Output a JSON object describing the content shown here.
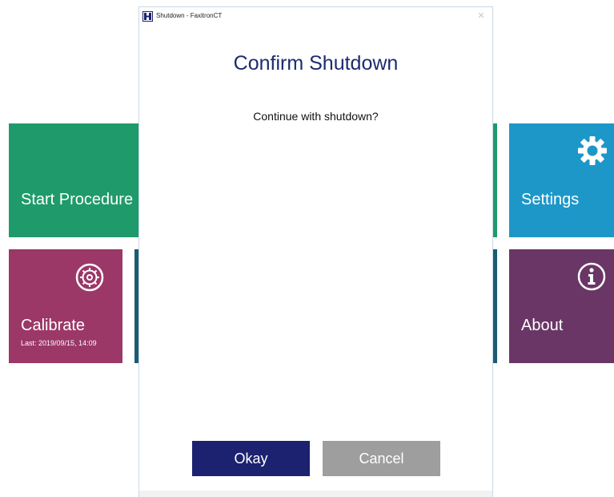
{
  "background_tiles": {
    "start_procedure": {
      "label": "Start Procedure",
      "color": "#1f9a6b"
    },
    "settings": {
      "label": "Settings",
      "color": "#1d97c8",
      "icon": "gear-icon"
    },
    "calibrate": {
      "label": "Calibrate",
      "sublabel": "Last: 2019/09/15, 14:09",
      "color": "#9b3868",
      "icon": "calibrate-gear-icon"
    },
    "middle": {
      "color": "#1b5b73"
    },
    "about": {
      "label": "About",
      "color": "#6a3666",
      "icon": "info-icon"
    }
  },
  "dialog": {
    "window_title": "Shutdown - FaxitronCT",
    "close_glyph": "✕",
    "title": "Confirm Shutdown",
    "message": "Continue with shutdown?",
    "okay_label": "Okay",
    "cancel_label": "Cancel",
    "title_color": "#1e2a6f",
    "okay_color": "#1c2270",
    "cancel_color": "#9e9e9e"
  }
}
